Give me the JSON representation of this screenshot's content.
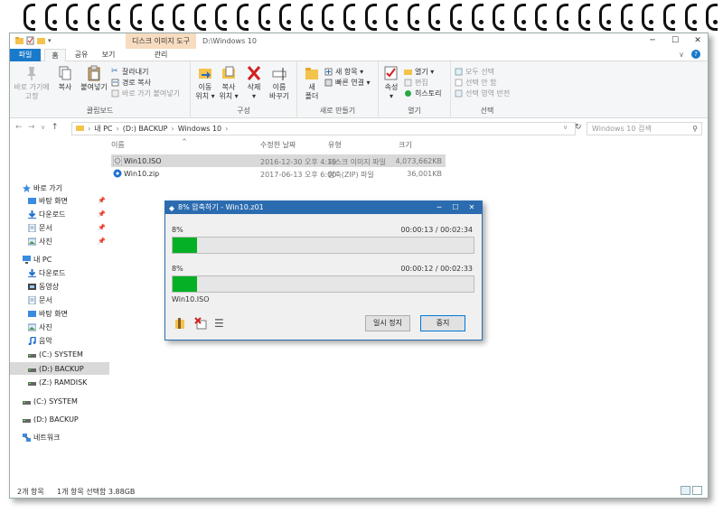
{
  "window_title": "D:\\Windows 10",
  "context_tab": "디스크 이미지 도구",
  "ribbon_tabs": {
    "file": "파일",
    "home": "홈",
    "share": "공유",
    "view": "보기",
    "manage": "관리"
  },
  "ribbon": {
    "clipboard": {
      "label": "클립보드",
      "pin": "바로 가기에\n고정",
      "copy": "복사",
      "paste": "붙여넣기",
      "cut": "잘라내기",
      "copy_path": "경로 복사",
      "paste_shortcut": "바로 가기 붙여넣기"
    },
    "organize": {
      "label": "구성",
      "move_to": "이동\n위치 ▾",
      "copy_to": "복사\n위치 ▾",
      "delete": "삭제\n▾",
      "rename": "이름\n바꾸기"
    },
    "new": {
      "label": "새로 만들기",
      "new_folder": "새\n폴더",
      "new_item": "새 항목 ▾",
      "easy_access": "빠른 연결 ▾"
    },
    "open": {
      "label": "열기",
      "properties": "속성\n▾",
      "open": "열기 ▾",
      "edit": "편집",
      "history": "히스토리"
    },
    "select": {
      "label": "선택",
      "select_all": "모두 선택",
      "select_none": "선택 안 함",
      "invert": "선택 영역 반전"
    }
  },
  "address": {
    "segments": [
      "내 PC",
      "(D:) BACKUP",
      "Windows 10"
    ],
    "search_placeholder": "Windows 10 검색"
  },
  "nav": {
    "quick_access": "바로 가기",
    "quick_items": [
      "바탕 화면",
      "다운로드",
      "문서",
      "사진"
    ],
    "this_pc": "내 PC",
    "pc_items": [
      "다운로드",
      "동영상",
      "문서",
      "바탕 화면",
      "사진",
      "음악",
      "(C:) SYSTEM",
      "(D:) BACKUP",
      "(Z:) RAMDISK"
    ],
    "drives": [
      "(C:) SYSTEM",
      "(D:) BACKUP"
    ],
    "network": "네트워크"
  },
  "columns": {
    "name": "이름",
    "date": "수정한 날짜",
    "type": "유형",
    "size": "크기"
  },
  "files": [
    {
      "name": "Win10.ISO",
      "date": "2016-12-30 오후 4:39",
      "type": "디스크 이미지 파일",
      "size": "4,073,662KB"
    },
    {
      "name": "Win10.zip",
      "date": "2017-06-13 오후 6:00",
      "type": "압축(ZIP) 파일",
      "size": "36,001KB"
    }
  ],
  "status": {
    "count": "2개 항목",
    "selected": "1개 항목 선택함 3.88GB"
  },
  "dialog": {
    "title": "8% 압축하기 - Win10.z01",
    "p1": {
      "percent": "8%",
      "time": "00:00:13 / 00:02:34",
      "progress": 0.08
    },
    "p2": {
      "percent": "8%",
      "time": "00:00:12 / 00:02:33",
      "progress": 0.08
    },
    "file": "Win10.ISO",
    "pause": "일시 정지",
    "stop": "중지"
  },
  "colors": {
    "accent": "#1979ca",
    "progress": "#06b025",
    "dialog_title": "#2b6cb0"
  }
}
